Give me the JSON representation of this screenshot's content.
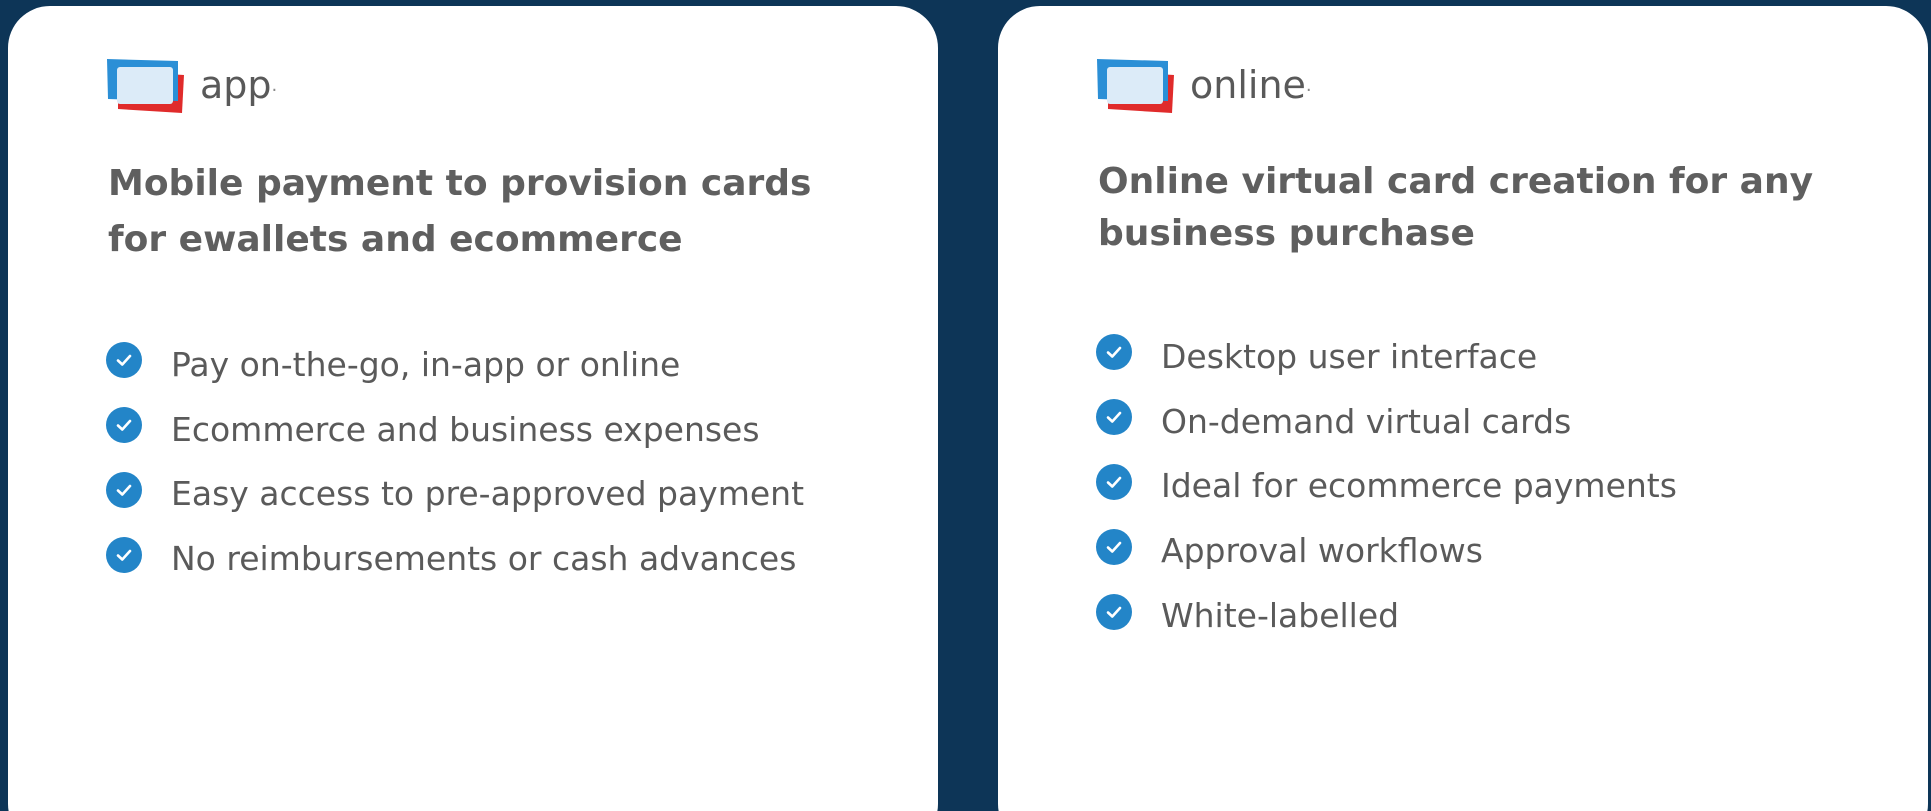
{
  "cards": [
    {
      "logo_word": "app",
      "logo_dot": ".",
      "headline": "Mobile payment to provision cards for ewallets and ecommerce",
      "features": [
        "Pay on-the-go, in-app or online",
        "Ecommerce and business expenses",
        "Easy access to pre-approved payment",
        "No reimbursements or cash advances"
      ]
    },
    {
      "logo_word": "online",
      "logo_dot": ".",
      "headline": "Online virtual card creation for any business purchase",
      "features": [
        "Desktop user interface",
        "On-demand virtual cards",
        "Ideal for ecommerce payments",
        "Approval workflows",
        "White-labelled"
      ]
    }
  ],
  "colors": {
    "background": "#0d3557",
    "card": "#ffffff",
    "check": "#2385c8",
    "text": "#5a5a5a",
    "logo_blue": "#2b8fd6",
    "logo_red": "#e02b2b"
  },
  "icons": {
    "logo": "cards-logo-icon",
    "bullet": "check-circle-icon"
  }
}
